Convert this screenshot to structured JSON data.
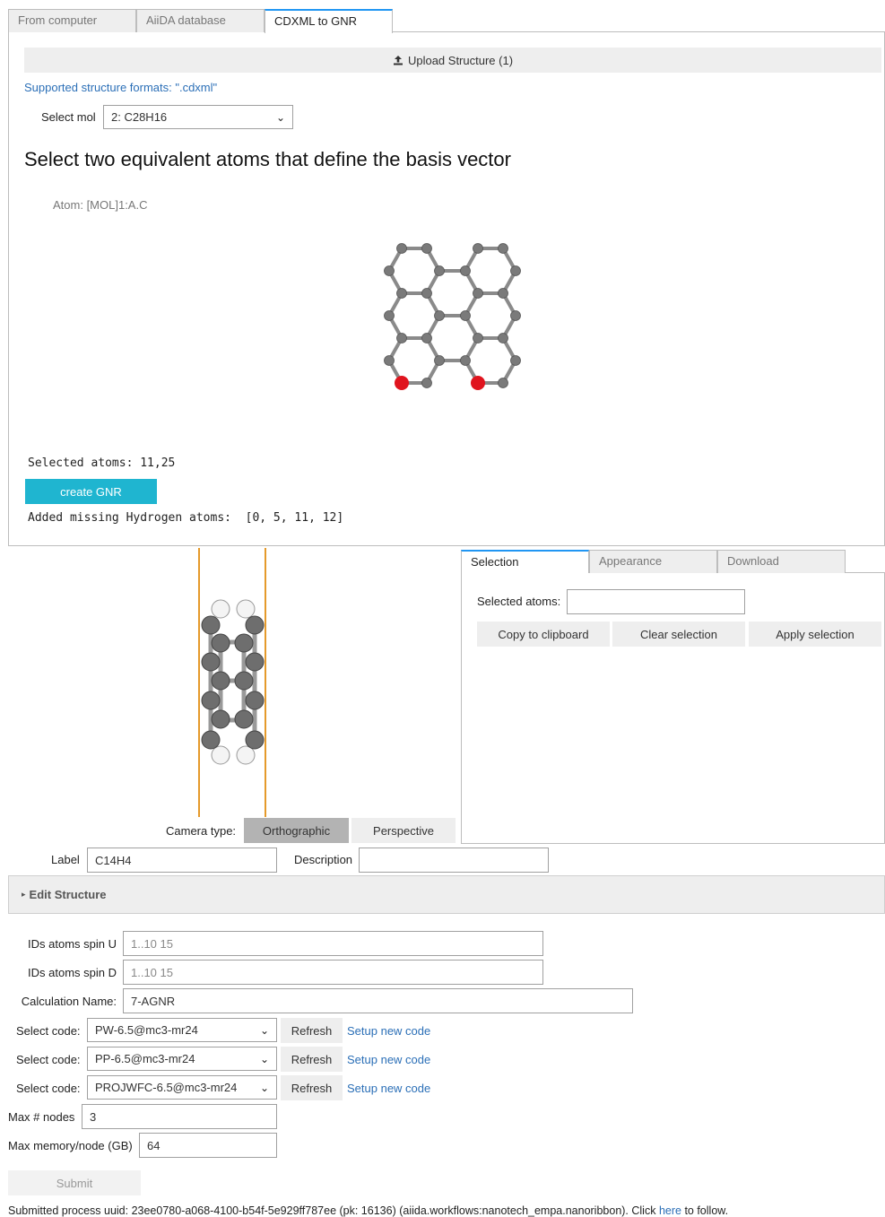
{
  "tabs": [
    {
      "label": "From computer"
    },
    {
      "label": "AiiDA database"
    },
    {
      "label": "CDXML to GNR"
    }
  ],
  "upload": {
    "label": "Upload Structure (1)"
  },
  "supported_formats": "Supported structure formats: \".cdxml\"",
  "select_mol": {
    "label": "Select mol",
    "value": "2: C28H16"
  },
  "heading": "Select two equivalent atoms that define the basis vector",
  "atom_info": "Atom: [MOL]1:A.C",
  "selected_atoms_text": "Selected atoms: 11,25",
  "create_gnr": {
    "label": "create GNR",
    "color": "#1fb5d0"
  },
  "added_h_text": "Added missing Hydrogen atoms:  [0, 5, 11, 12]",
  "camera": {
    "label": "Camera type:",
    "options": [
      "Orthographic",
      "Perspective"
    ],
    "selected": "Orthographic"
  },
  "viewer_tabs": [
    {
      "label": "Selection"
    },
    {
      "label": "Appearance"
    },
    {
      "label": "Download"
    }
  ],
  "selection_panel": {
    "selected_atoms_label": "Selected atoms:",
    "selected_atoms_value": "",
    "copy": "Copy to clipboard",
    "clear": "Clear selection",
    "apply": "Apply selection"
  },
  "label_field": {
    "label": "Label",
    "value": "C14H4"
  },
  "description_field": {
    "label": "Description",
    "value": ""
  },
  "edit_structure": {
    "label": "Edit Structure"
  },
  "spin_u": {
    "label": "IDs atoms spin U",
    "placeholder": "1..10 15"
  },
  "spin_d": {
    "label": "IDs atoms spin D",
    "placeholder": "1..10 15"
  },
  "calc_name": {
    "label": "Calculation Name:",
    "value": "7-AGNR"
  },
  "codes": [
    {
      "label": "Select code:",
      "value": "PW-6.5@mc3-mr24",
      "refresh": "Refresh",
      "setup": "Setup new code"
    },
    {
      "label": "Select code:",
      "value": "PP-6.5@mc3-mr24",
      "refresh": "Refresh",
      "setup": "Setup new code"
    },
    {
      "label": "Select code:",
      "value": "PROJWFC-6.5@mc3-mr24",
      "refresh": "Refresh",
      "setup": "Setup new code"
    }
  ],
  "max_nodes": {
    "label": "Max # nodes",
    "value": "3"
  },
  "max_memory": {
    "label": "Max memory/node (GB)",
    "value": "64"
  },
  "submit": {
    "label": "Submit"
  },
  "footer": {
    "text": "Submitted process uuid: 23ee0780-a068-4100-b54f-5e929ff787ee (pk: 16136) (aiida.workflows:nanotech_empa.nanoribbon). Click ",
    "link": "here",
    "tail": " to follow."
  },
  "colors": {
    "accent": "#2196f3",
    "atom_carbon": "#808080",
    "atom_selected": "#e0141e",
    "atom_hydrogen": "#ffffff",
    "cell_edge": "#e59a2b"
  },
  "icons": {
    "upload": "upload-icon",
    "caret": "chevron-down-icon",
    "triangle": "triangle-right-icon"
  }
}
